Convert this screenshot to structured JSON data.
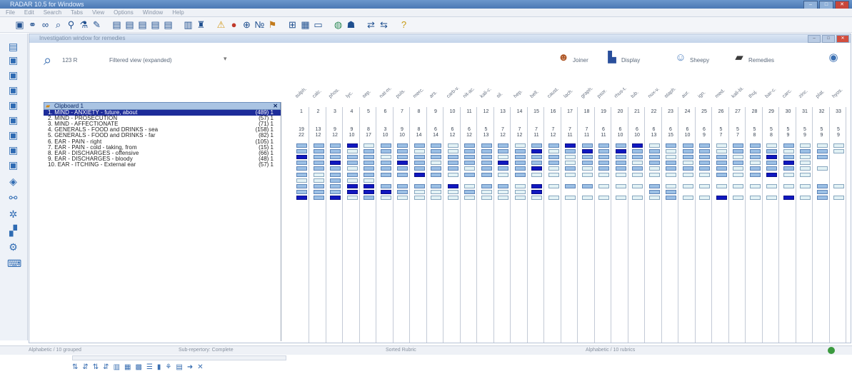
{
  "window": {
    "title": "RADAR 10.5 for Windows"
  },
  "menu": [
    "File",
    "Edit",
    "Search",
    "Tabs",
    "View",
    "Options",
    "Window",
    "Help"
  ],
  "analysis_window": {
    "title": "Investigation window for remedies"
  },
  "search": {
    "count": "123 R",
    "filter": "Filtered view (expanded)"
  },
  "actions": [
    {
      "icon": "person-icon",
      "label": "Joiner"
    },
    {
      "icon": "chart-icon",
      "label": "Display"
    },
    {
      "icon": "people-icon",
      "label": "Sheepy"
    },
    {
      "icon": "book-icon",
      "label": "Remedies"
    }
  ],
  "clipboard": {
    "title": "Clipboard 1",
    "rubrics": [
      {
        "label": "1. MIND - ANXIETY - future, about",
        "count": "(489) 1"
      },
      {
        "label": "2. MIND - PROSECUTION",
        "count": "(57) 1"
      },
      {
        "label": "3. MIND - AFFECTIONATE",
        "count": "(71) 1"
      },
      {
        "label": "4. GENERALS - FOOD and DRINKS - sea",
        "count": "(158) 1"
      },
      {
        "label": "5. GENERALS - FOOD and DRINKS - far",
        "count": "(82) 1"
      },
      {
        "label": "6. EAR - PAIN - right",
        "count": "(105) 1"
      },
      {
        "label": "7. EAR - PAIN - cold - taking, from",
        "count": "(15) 1"
      },
      {
        "label": "8. EAR - DISCHARGES - offensive",
        "count": "(66) 1"
      },
      {
        "label": "9. EAR - DISCHARGES - bloody",
        "count": "(48) 1"
      },
      {
        "label": "10. EAR - ITCHING - External ear",
        "count": "(57) 1"
      }
    ]
  },
  "grid": {
    "remedies": [
      "sulph.",
      "calc.",
      "phos.",
      "lyc.",
      "sep.",
      "nat-m.",
      "puls.",
      "merc.",
      "ars.",
      "carb-v.",
      "nit-ac.",
      "kali-c.",
      "sil.",
      "hep.",
      "bell.",
      "caust.",
      "lach.",
      "graph.",
      "psor.",
      "rhus-t.",
      "tub.",
      "nux-v.",
      "staph.",
      "aur.",
      "ign.",
      "med.",
      "kali-bi.",
      "thuj.",
      "bar-c.",
      "carc.",
      "zinc.",
      "plat.",
      "hyos."
    ],
    "col_numbers": [
      "1",
      "2",
      "3",
      "4",
      "5",
      "6",
      "7",
      "8",
      "9",
      "10",
      "11",
      "12",
      "13",
      "14",
      "15",
      "16",
      "17",
      "18",
      "19",
      "20",
      "21",
      "22",
      "23",
      "24",
      "25",
      "26",
      "27",
      "28",
      "29",
      "30",
      "31",
      "32",
      "33"
    ],
    "totals": [
      "19",
      "13",
      "9",
      "9",
      "8",
      "3",
      "9",
      "8",
      "6",
      "6",
      "6",
      "5",
      "7",
      "7",
      "7",
      "7",
      "7",
      "7",
      "6",
      "6",
      "6",
      "6",
      "6",
      "6",
      "6",
      "5",
      "5",
      "5",
      "5",
      "5",
      "5",
      "5",
      "5"
    ],
    "symptoms": [
      "22",
      "12",
      "12",
      "10",
      "17",
      "10",
      "10",
      "14",
      "14",
      "12",
      "12",
      "13",
      "12",
      "12",
      "11",
      "12",
      "11",
      "11",
      "11",
      "10",
      "10",
      "13",
      "15",
      "10",
      "9",
      "7",
      "7",
      "8",
      "8",
      "9",
      "9",
      "9",
      "9"
    ],
    "intensity": [
      [
        2,
        2,
        2,
        3,
        1,
        2,
        2,
        2,
        2,
        1,
        2,
        2,
        2,
        1,
        2,
        2,
        3,
        2,
        2,
        2,
        3,
        1,
        2,
        2,
        2,
        1,
        2,
        2,
        1,
        2,
        1,
        1,
        1
      ],
      [
        2,
        2,
        2,
        1,
        2,
        2,
        2,
        1,
        2,
        1,
        2,
        2,
        2,
        2,
        3,
        1,
        2,
        3,
        2,
        3,
        2,
        2,
        1,
        2,
        2,
        1,
        2,
        2,
        2,
        1,
        2,
        2,
        1
      ],
      [
        3,
        2,
        2,
        2,
        2,
        1,
        2,
        2,
        2,
        2,
        2,
        2,
        1,
        2,
        2,
        2,
        1,
        2,
        2,
        2,
        2,
        2,
        1,
        2,
        2,
        2,
        1,
        2,
        3,
        2,
        1,
        2,
        0
      ],
      [
        2,
        2,
        3,
        2,
        2,
        2,
        3,
        2,
        1,
        2,
        2,
        2,
        3,
        2,
        2,
        2,
        1,
        2,
        2,
        2,
        1,
        2,
        2,
        1,
        2,
        2,
        2,
        1,
        2,
        3,
        1,
        0,
        0
      ],
      [
        2,
        2,
        2,
        1,
        2,
        2,
        2,
        2,
        2,
        2,
        1,
        2,
        2,
        2,
        3,
        1,
        2,
        1,
        2,
        2,
        2,
        1,
        2,
        2,
        2,
        2,
        1,
        2,
        2,
        2,
        1,
        1,
        0
      ],
      [
        2,
        1,
        2,
        2,
        2,
        2,
        2,
        3,
        2,
        1,
        2,
        2,
        1,
        2,
        1,
        1,
        1,
        1,
        1,
        1,
        1,
        1,
        1,
        1,
        1,
        2,
        1,
        2,
        3,
        1,
        1,
        0,
        0
      ],
      [
        1,
        1,
        2,
        1,
        1,
        0,
        0,
        0,
        0,
        0,
        0,
        0,
        0,
        0,
        0,
        0,
        0,
        0,
        0,
        0,
        0,
        0,
        0,
        0,
        0,
        0,
        0,
        0,
        0,
        0,
        0,
        0,
        0
      ],
      [
        2,
        2,
        2,
        3,
        3,
        2,
        2,
        2,
        2,
        3,
        1,
        2,
        2,
        1,
        3,
        1,
        2,
        2,
        1,
        1,
        1,
        2,
        1,
        1,
        1,
        1,
        1,
        1,
        1,
        1,
        1,
        2,
        1
      ],
      [
        2,
        2,
        2,
        3,
        3,
        3,
        2,
        1,
        1,
        1,
        2,
        1,
        1,
        1,
        3,
        0,
        0,
        0,
        0,
        0,
        0,
        2,
        2,
        0,
        0,
        0,
        0,
        0,
        0,
        0,
        0,
        2,
        0
      ],
      [
        3,
        2,
        3,
        1,
        2,
        1,
        1,
        1,
        1,
        1,
        1,
        1,
        1,
        1,
        1,
        1,
        1,
        1,
        1,
        1,
        1,
        1,
        2,
        1,
        1,
        3,
        1,
        1,
        1,
        3,
        1,
        2,
        1
      ]
    ]
  },
  "status": {
    "left": "Alphabetic / 10 grouped",
    "mid": "Sub-repertory: Complete",
    "center": "Sorted Rubric",
    "right": "Alphabetic / 10 rubrics"
  }
}
